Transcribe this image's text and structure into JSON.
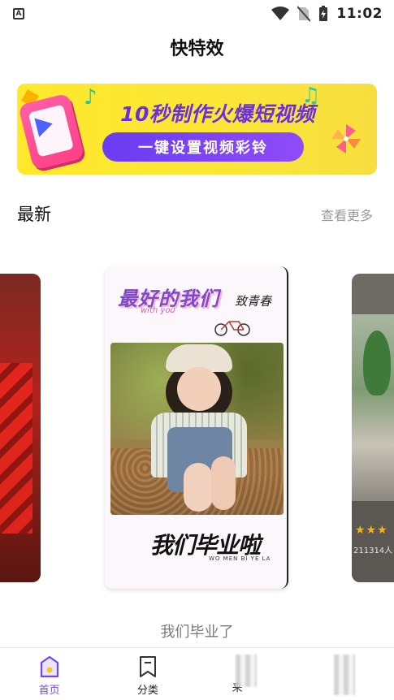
{
  "status_bar": {
    "left_badge": "A",
    "time": "11:02"
  },
  "header": {
    "title": "快特效"
  },
  "banner": {
    "headline": "10秒制作火爆短视频",
    "pill_text": "一键设置视频彩铃"
  },
  "section": {
    "title": "最新",
    "more_label": "查看更多"
  },
  "carousel": {
    "main_card": {
      "title_art": "最好的我们",
      "with_you": "with you",
      "young_text": "致青春",
      "grad_art": "我们毕业啦",
      "grad_sub": "WO MEN BI YE LA"
    },
    "right_card": {
      "stars": "★★★",
      "count": "211314人"
    },
    "caption": "我们毕业了"
  },
  "tab_bar": {
    "tabs": [
      {
        "label": "首页",
        "active": true
      },
      {
        "label": "分类",
        "active": false
      },
      {
        "label": "来",
        "active": false
      },
      {
        "label": "",
        "active": false
      }
    ]
  },
  "colors": {
    "accent": "#6f49e8",
    "banner_bg": "#ffe92a",
    "banner_pill": "#7a42f5"
  }
}
